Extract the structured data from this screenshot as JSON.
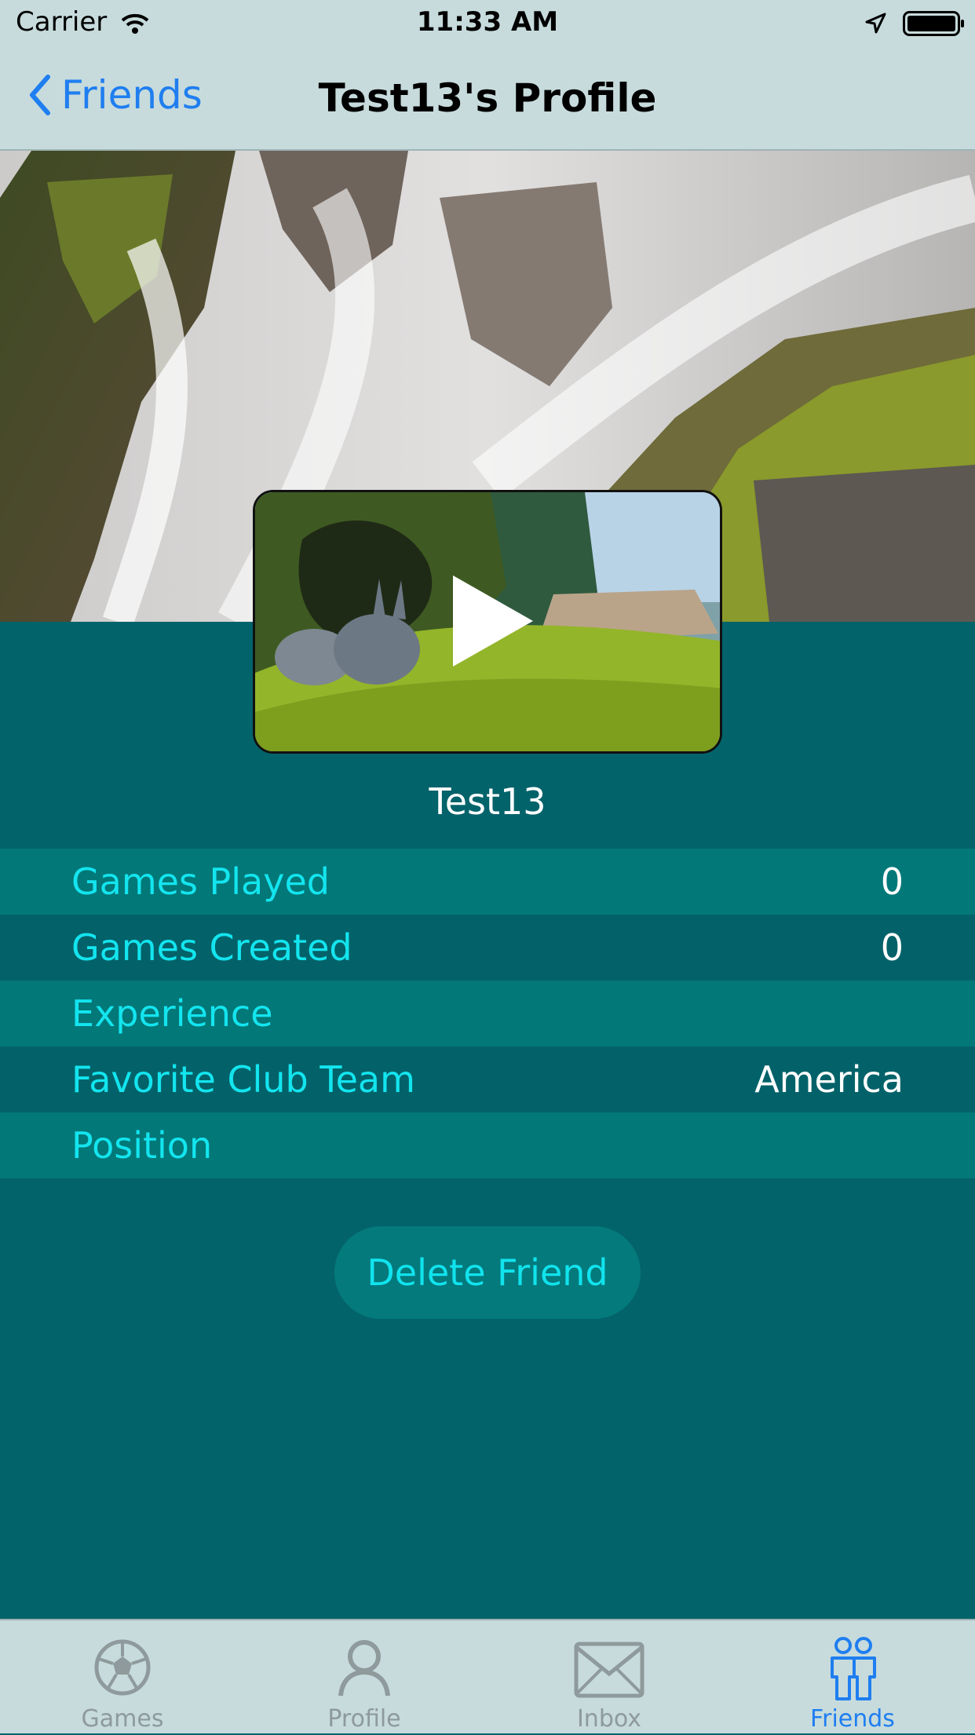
{
  "status_bar": {
    "carrier": "Carrier",
    "time": "11:33 AM"
  },
  "nav": {
    "back_label": "Friends",
    "title": "Test13's Profile"
  },
  "profile": {
    "username": "Test13"
  },
  "stats": [
    {
      "label": "Games Played",
      "value": "0"
    },
    {
      "label": "Games Created",
      "value": "0"
    },
    {
      "label": "Experience",
      "value": ""
    },
    {
      "label": "Favorite Club Team",
      "value": "America"
    },
    {
      "label": "Position",
      "value": ""
    }
  ],
  "actions": {
    "delete_label": "Delete Friend"
  },
  "tabs": [
    {
      "label": "Games",
      "icon": "soccer-ball-icon"
    },
    {
      "label": "Profile",
      "icon": "person-icon"
    },
    {
      "label": "Inbox",
      "icon": "envelope-icon"
    },
    {
      "label": "Friends",
      "icon": "friends-icon",
      "active": true
    }
  ],
  "colors": {
    "background": "#03636a",
    "bar": "#c7dbdc",
    "accent": "#1f7ef0",
    "label": "#13e5ef",
    "row_light": "#037878",
    "row_dark": "#036269"
  }
}
